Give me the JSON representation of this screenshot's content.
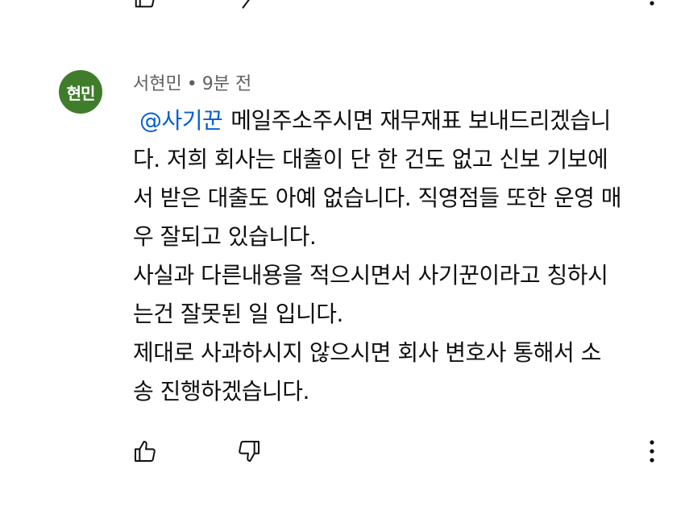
{
  "comment": {
    "avatar_text": "현민",
    "author": "서현민",
    "separator": "•",
    "time": "9분 전",
    "mention": "@사기꾼",
    "lines": [
      "메일주소주시면 재무재표 보내드리겠습니",
      "다. 저희 회사는 대출이 단 한 건도 없고 신보 기보에",
      "서 받은 대출도 아예 없습니다. 직영점들 또한 운영 매",
      "우 잘되고 있습니다.",
      "사실과 다른내용을 적으시면서 사기꾼이라고 칭하시",
      "는건 잘못된 일 입니다.",
      "제대로 사과하시지 않으시면 회사 변호사 통해서 소",
      "송 진행하겠습니다."
    ]
  },
  "icons": {
    "like": "thumbs-up-icon",
    "dislike": "thumbs-down-icon",
    "more": "more-vertical-icon"
  },
  "colors": {
    "avatar_bg": "#3f7d2b",
    "mention": "#065fd4",
    "meta": "#606060",
    "text": "#0f0f0f"
  }
}
